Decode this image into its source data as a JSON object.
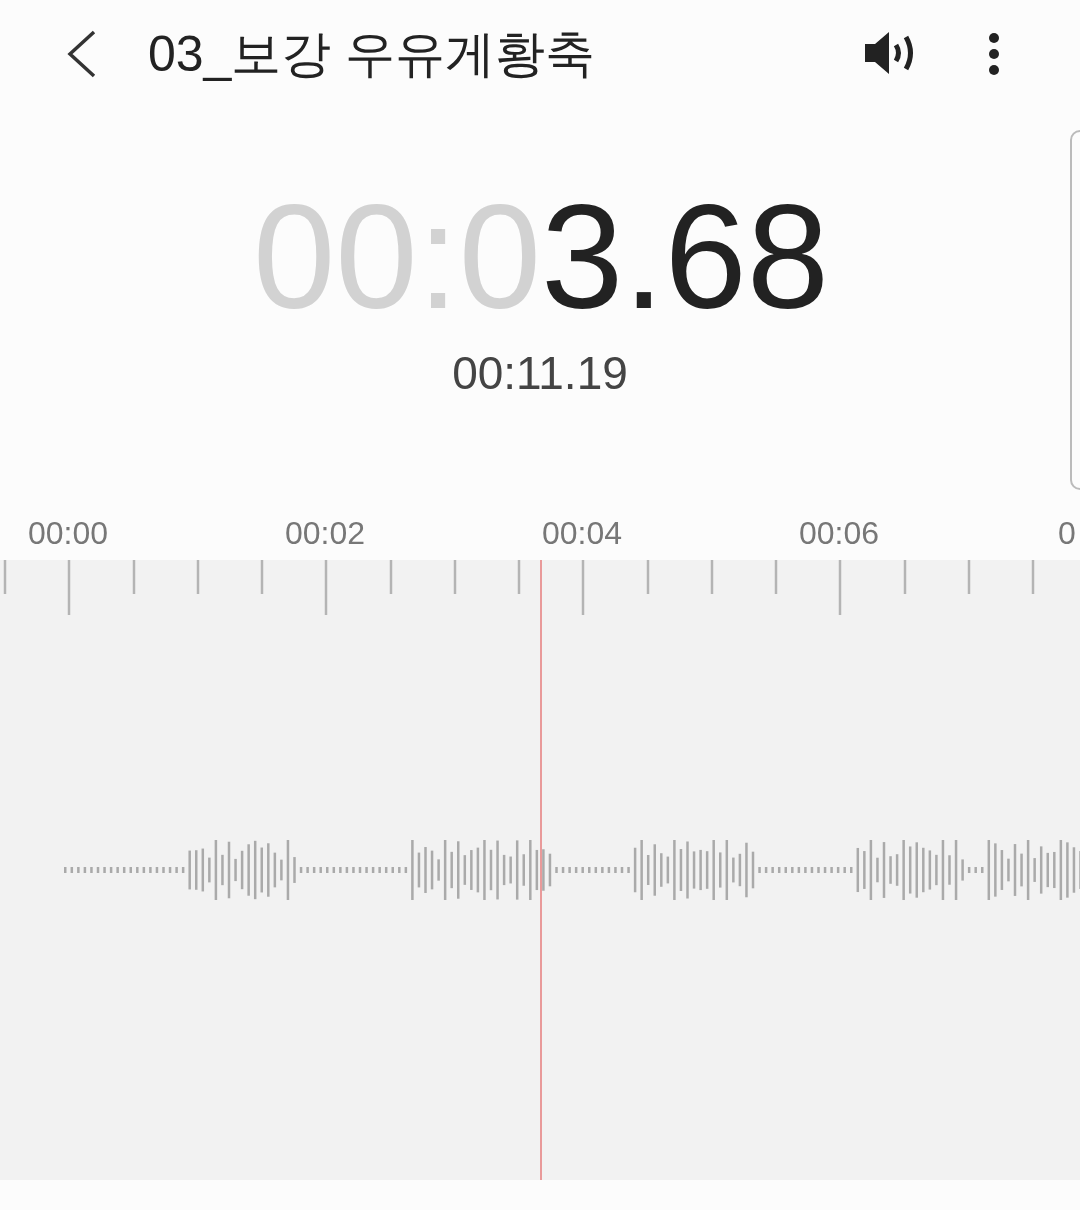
{
  "header": {
    "title": "03_보강 우유게황축"
  },
  "timer": {
    "elapsed_dim": "00:0",
    "elapsed_lit": "3.68",
    "total": "00:11.19"
  },
  "timeline": {
    "labels": [
      "00:00",
      "00:02",
      "00:04",
      "00:06",
      "0"
    ]
  }
}
